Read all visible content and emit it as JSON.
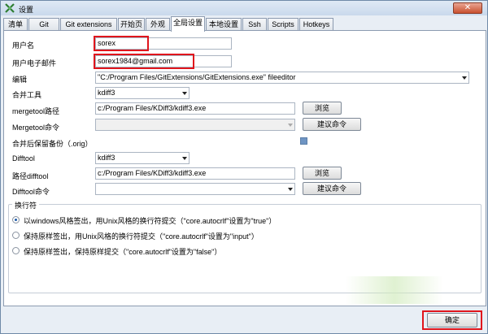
{
  "window": {
    "title": "设置",
    "close_glyph": "✕"
  },
  "tabs": [
    {
      "label": "清单"
    },
    {
      "label": "Git"
    },
    {
      "label": "Git extensions"
    },
    {
      "label": "开始页"
    },
    {
      "label": "外观"
    },
    {
      "label": "全局设置"
    },
    {
      "label": "本地设置"
    },
    {
      "label": "Ssh"
    },
    {
      "label": "Scripts"
    },
    {
      "label": "Hotkeys"
    }
  ],
  "active_tab": "全局设置",
  "form": {
    "username_label": "用户名",
    "username_value": "sorex",
    "email_label": "用户电子邮件",
    "email_value": "sorex1984@gmail.com",
    "editor_label": "编辑",
    "editor_value": "\"C:/Program Files/GitExtensions/GitExtensions.exe\" fileeditor",
    "mergetool_label": "合并工具",
    "mergetool_value": "kdiff3",
    "mergetool_path_label": "mergetool路径",
    "mergetool_path_value": "c:/Program Files/KDiff3/kdiff3.exe",
    "mergetool_cmd_label": "Mergetool命令",
    "mergetool_cmd_value": "",
    "keep_backup_label": "合并后保留备份（.orig）",
    "difftool_label": "Difftool",
    "difftool_value": "kdiff3",
    "difftool_path_label": "路径difftool",
    "difftool_path_value": "c:/Program Files/KDiff3/kdiff3.exe",
    "difftool_cmd_label": "Difftool命令",
    "difftool_cmd_value": "",
    "browse_label": "浏览",
    "suggest_cmd_label": "建议命令"
  },
  "line_endings": {
    "title": "换行符",
    "options": [
      {
        "label": "以windows风格签出，用Unix风格的换行符提交（\"core.autocrlf\"设置为\"true\"）",
        "checked": true
      },
      {
        "label": "保持原样签出，用Unix风格的换行符提交（\"core.autocrlf\"设置为\"input\"）",
        "checked": false
      },
      {
        "label": "保持原样签出，保持原样提交（\"core.autocrlf\"设置为\"false\"）",
        "checked": false
      }
    ]
  },
  "footer": {
    "ok_label": "确定"
  },
  "colors": {
    "highlight": "#e0151c",
    "frame": "#e8eef5",
    "accent": "#1c5aa8"
  },
  "icons": {
    "app": "gitextensions-icon",
    "close": "close-icon"
  }
}
